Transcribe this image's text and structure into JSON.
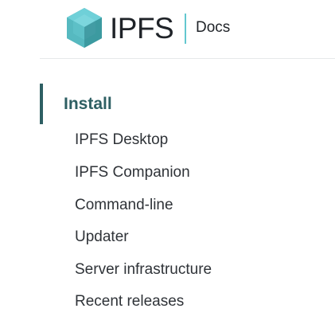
{
  "header": {
    "logo_text": "IPFS",
    "section_label": "Docs",
    "brand_color": "#63c7cf",
    "logo_icon": "cube-icon"
  },
  "sidebar": {
    "section_title": "Install",
    "active_color": "#2e5f63",
    "items": [
      {
        "label": "IPFS Desktop"
      },
      {
        "label": "IPFS Companion"
      },
      {
        "label": "Command-line"
      },
      {
        "label": "Updater"
      },
      {
        "label": "Server infrastructure"
      },
      {
        "label": "Recent releases"
      }
    ]
  }
}
